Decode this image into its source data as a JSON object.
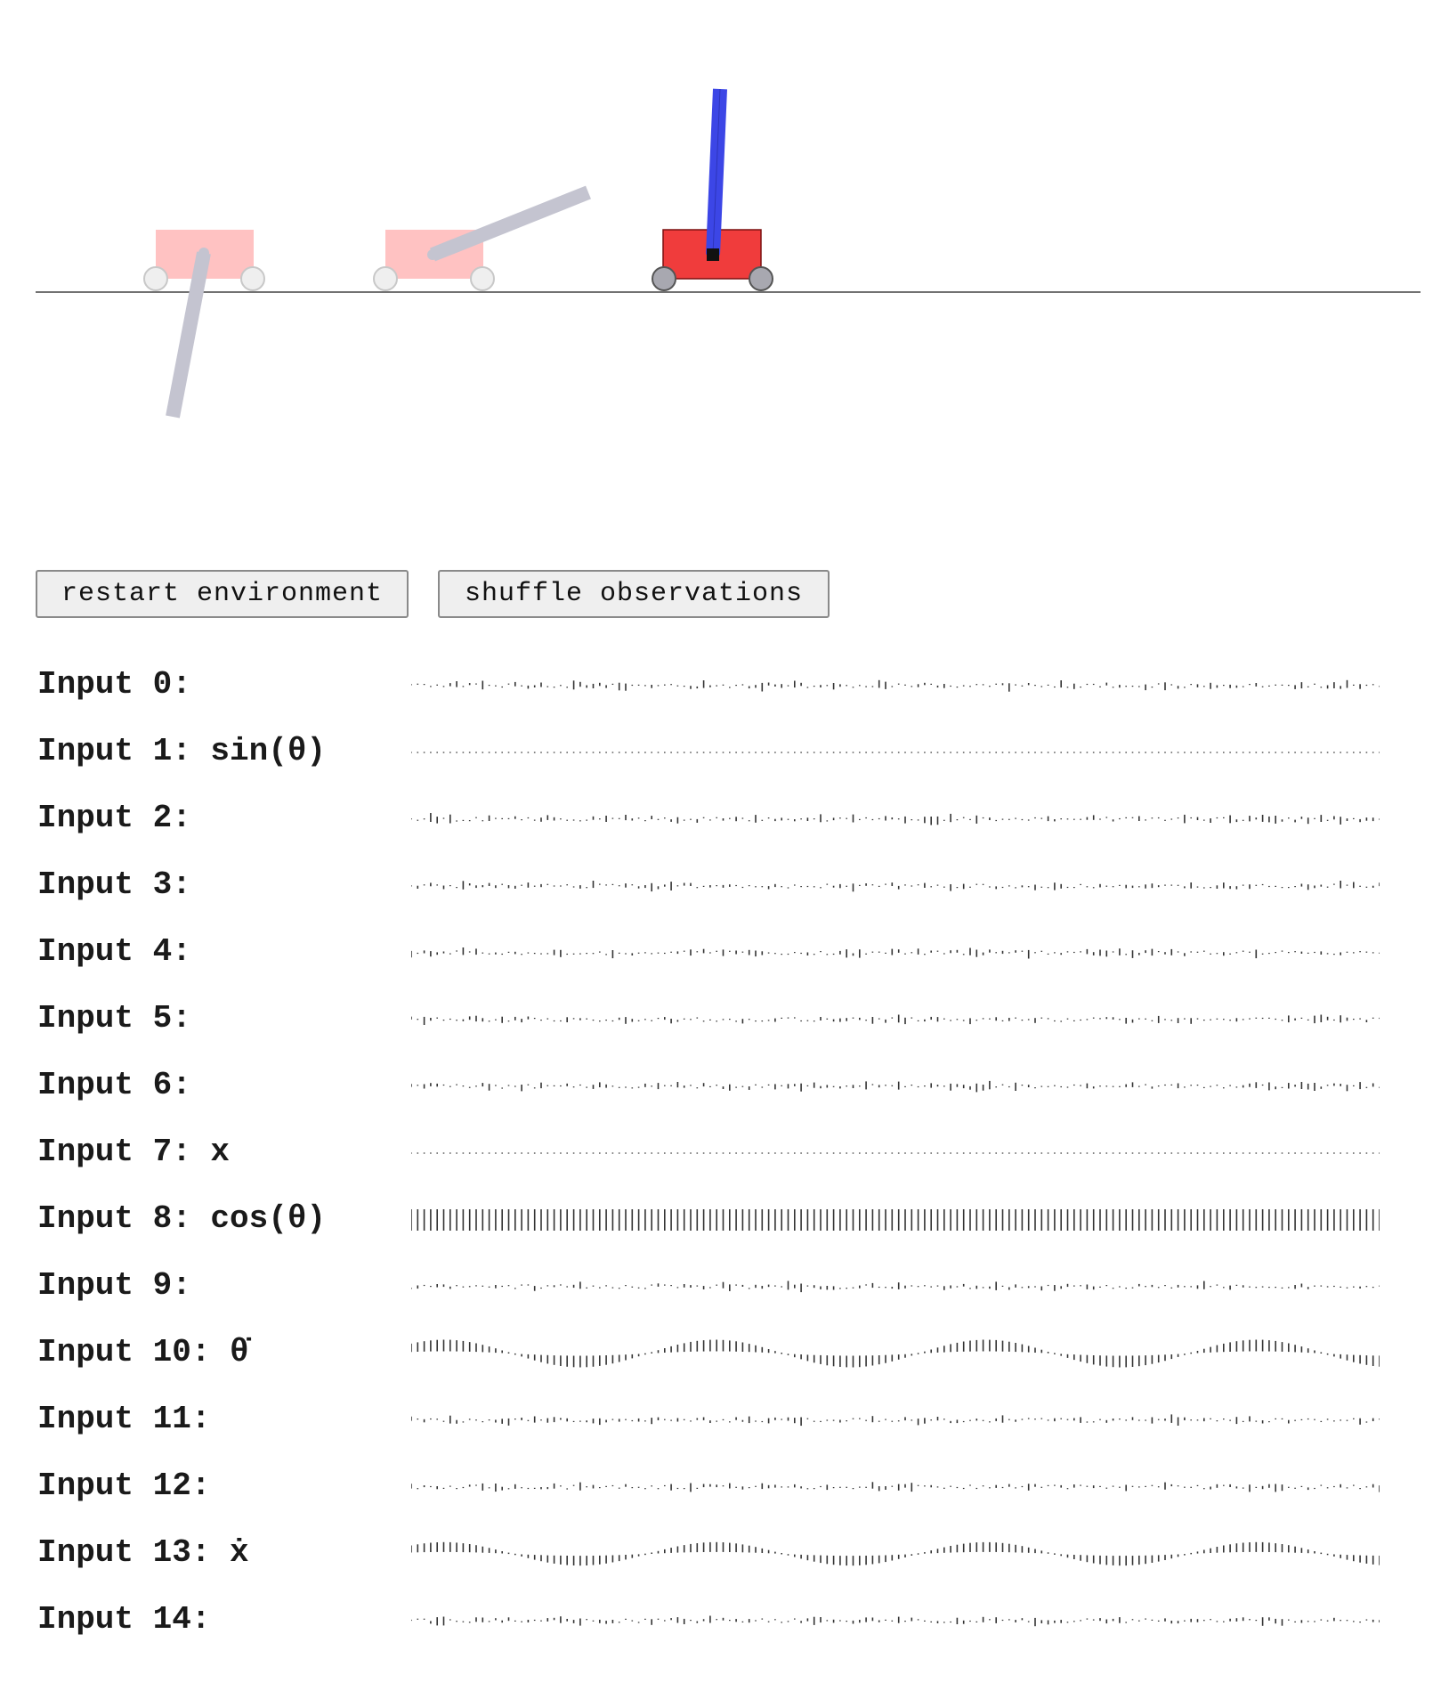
{
  "controls": {
    "restart_label": "restart environment",
    "shuffle_label": "shuffle observations"
  },
  "colors": {
    "active_cart": "#f03c3c",
    "active_pole": "#3c46e6",
    "ghost_cart": "#ffc2c2",
    "ghost_pole": "#c4c4d0",
    "wheel": "#b8b8c0",
    "ground": "#444444",
    "tick": "#333333"
  },
  "observations": [
    {
      "label": "Input 0:",
      "pattern": "noise",
      "amp": 0.25
    },
    {
      "label": "Input 1: sin(θ)",
      "pattern": "flat",
      "amp": 0.02
    },
    {
      "label": "Input 2:",
      "pattern": "noise",
      "amp": 0.25
    },
    {
      "label": "Input 3:",
      "pattern": "noise",
      "amp": 0.25
    },
    {
      "label": "Input 4:",
      "pattern": "noise",
      "amp": 0.25
    },
    {
      "label": "Input 5:",
      "pattern": "noise",
      "amp": 0.25
    },
    {
      "label": "Input 6:",
      "pattern": "noise",
      "amp": 0.25
    },
    {
      "label": "Input 7: x",
      "pattern": "flat",
      "amp": 0.02
    },
    {
      "label": "Input 8: cos(θ)",
      "pattern": "full",
      "amp": 1.0
    },
    {
      "label": "Input 9:",
      "pattern": "noise",
      "amp": 0.25
    },
    {
      "label": "Input 10: θ̇",
      "pattern": "wave",
      "amp": 1.0
    },
    {
      "label": "Input 11:",
      "pattern": "noise",
      "amp": 0.25
    },
    {
      "label": "Input 12:",
      "pattern": "noise",
      "amp": 0.25
    },
    {
      "label": "Input 13: ẋ",
      "pattern": "wave",
      "amp": 0.85
    },
    {
      "label": "Input 14:",
      "pattern": "noise",
      "amp": 0.25
    }
  ]
}
